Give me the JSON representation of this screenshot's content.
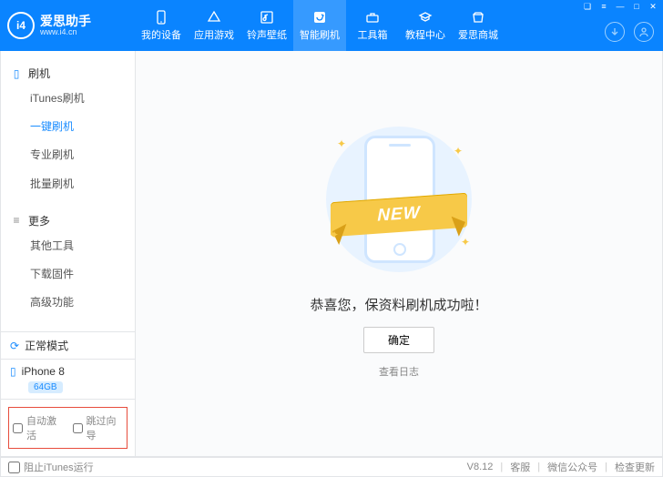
{
  "header": {
    "logo_text": "爱思助手",
    "logo_sub": "www.i4.cn",
    "logo_badge": "i4",
    "nav": [
      {
        "label": "我的设备",
        "icon": "device-icon"
      },
      {
        "label": "应用游戏",
        "icon": "apps-icon"
      },
      {
        "label": "铃声壁纸",
        "icon": "music-icon"
      },
      {
        "label": "智能刷机",
        "icon": "flash-icon",
        "active": true
      },
      {
        "label": "工具箱",
        "icon": "toolbox-icon"
      },
      {
        "label": "教程中心",
        "icon": "tutorial-icon"
      },
      {
        "label": "爱思商城",
        "icon": "store-icon"
      }
    ],
    "right_icons": {
      "download": "↓",
      "user": "◯"
    }
  },
  "sidebar": {
    "groups": [
      {
        "title": "刷机",
        "icon": "phone-icon",
        "items": [
          {
            "label": "iTunes刷机"
          },
          {
            "label": "一键刷机",
            "active": true
          },
          {
            "label": "专业刷机"
          },
          {
            "label": "批量刷机"
          }
        ]
      },
      {
        "title": "更多",
        "icon": "more-icon",
        "items": [
          {
            "label": "其他工具"
          },
          {
            "label": "下载固件"
          },
          {
            "label": "高级功能"
          }
        ]
      }
    ],
    "status": {
      "label": "正常模式",
      "icon": "sync-icon"
    },
    "device": {
      "name": "iPhone 8",
      "storage": "64GB",
      "icon": "device-small-icon"
    },
    "bottom": {
      "opt1": "自动激活",
      "opt2": "跳过向导"
    }
  },
  "content": {
    "ribbon_text": "NEW",
    "success_text": "恭喜您，保资料刷机成功啦！",
    "ok_label": "确定",
    "log_label": "查看日志"
  },
  "footer": {
    "block_itunes": "阻止iTunes运行",
    "version": "V8.12",
    "links": [
      "客服",
      "微信公众号",
      "检查更新"
    ]
  }
}
